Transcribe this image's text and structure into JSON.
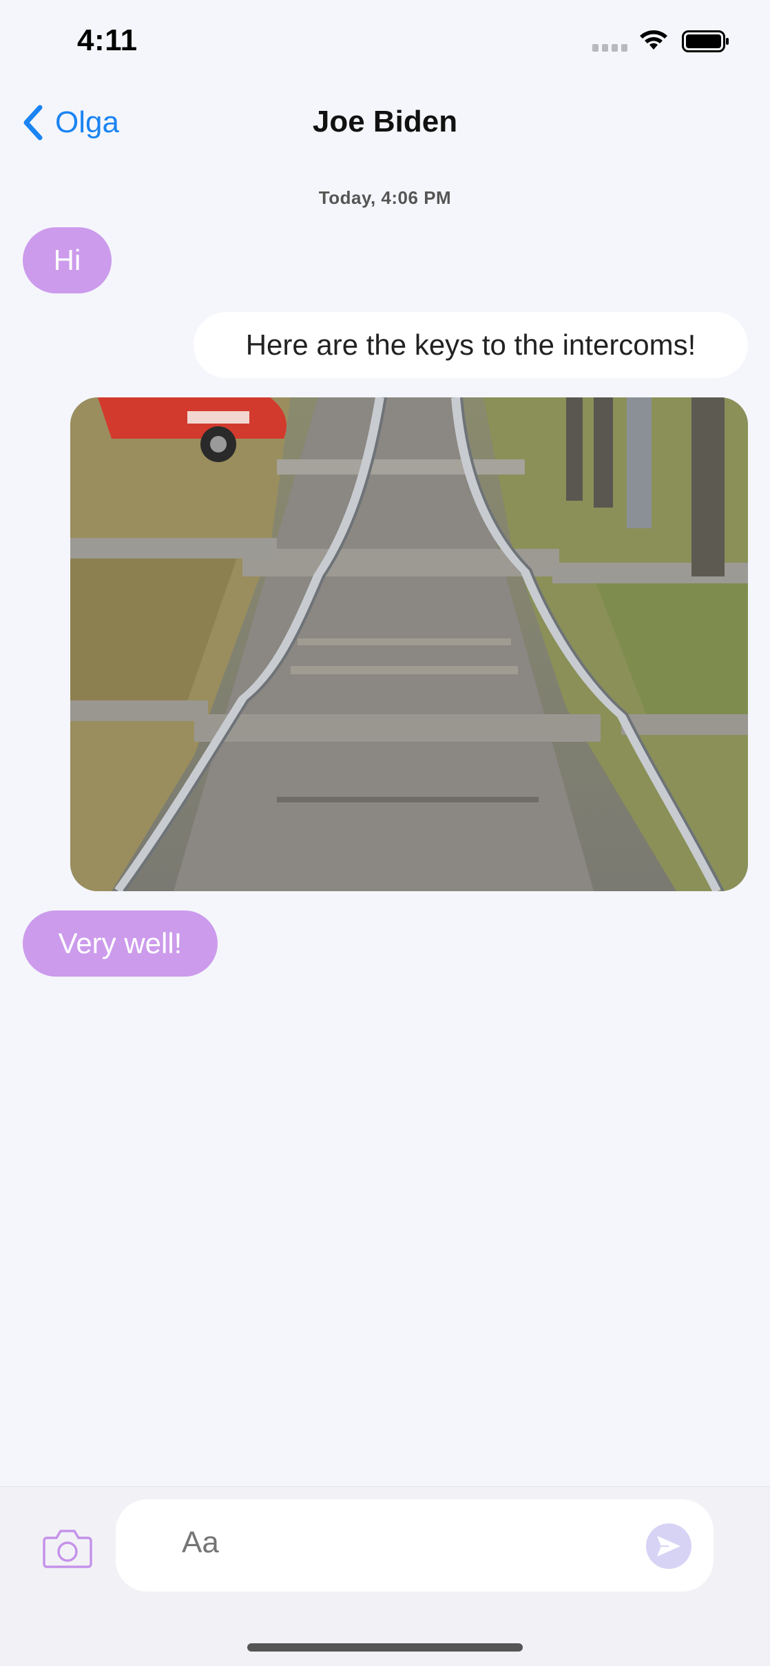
{
  "status_bar": {
    "time": "4:11"
  },
  "nav": {
    "back_label": "Olga",
    "title": "Joe Biden"
  },
  "conversation": {
    "timestamp": "Today, 4:06 PM",
    "messages": [
      {
        "direction": "incoming",
        "text": "Hi"
      },
      {
        "direction": "outgoing",
        "text": "Here are the keys to the intercoms!"
      },
      {
        "direction": "outgoing",
        "type": "image",
        "image_icon": "photo-railway-tracks"
      },
      {
        "direction": "incoming",
        "text": "Very well!"
      }
    ]
  },
  "composer": {
    "placeholder": "Aa",
    "camera_icon": "camera-icon",
    "send_icon": "send-icon"
  },
  "colors": {
    "accent": "#1a84f2",
    "incoming_bubble": "#cc9bec",
    "outgoing_bubble": "#ffffff",
    "background": "#f5f6fb"
  }
}
